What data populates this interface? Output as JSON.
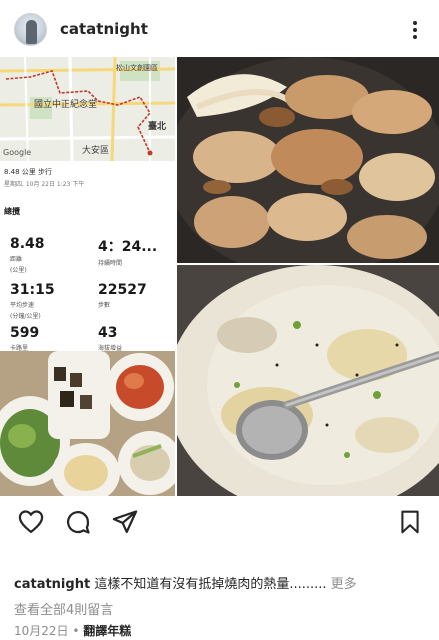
{
  "header": {
    "username": "catatnight"
  },
  "collage": {
    "map": {
      "labels": [
        "國立中正紀念堂",
        "大安區",
        "臺北",
        "松山文創園區"
      ],
      "attribution": "Google"
    },
    "stats": {
      "subtitle": "8.48 公里 步行",
      "date": "星期四, 10月 22日 1:23 下午",
      "heading": "總攬",
      "metrics": [
        {
          "value": "8.48",
          "label": "距離",
          "sublabel": "(公里)"
        },
        {
          "value": "4：24...",
          "label": "持續時間",
          "sublabel": ""
        },
        {
          "value": "31:15",
          "label": "平均步速",
          "sublabel": "(分鐘/公里)"
        },
        {
          "value": "22527",
          "label": "步數",
          "sublabel": ""
        },
        {
          "value": "599",
          "label": "卡路里",
          "sublabel": ""
        },
        {
          "value": "43",
          "label": "海拔增益",
          "sublabel": ""
        }
      ]
    }
  },
  "actions": {
    "like_icon": "heart-icon",
    "comment_icon": "comment-icon",
    "share_icon": "share-icon",
    "save_icon": "bookmark-icon"
  },
  "caption": {
    "username": "catatnight",
    "text": "這樣不知道有沒有抵掉燒肉的熱量.........",
    "more_label": "更多"
  },
  "comments": {
    "view_all_label": "查看全部4則留言"
  },
  "meta": {
    "date": "10月22日",
    "separator": "•",
    "translate_label": "翻譯年糕"
  },
  "colors": {
    "text": "#262626",
    "secondary": "#8e8e8e",
    "background": "#ffffff"
  }
}
